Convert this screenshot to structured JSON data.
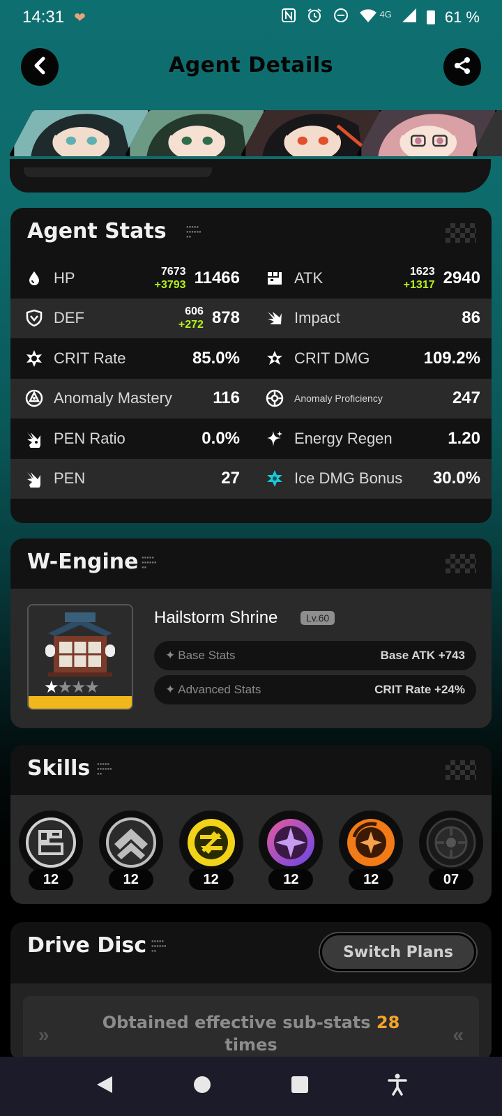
{
  "status_bar": {
    "time": "14:31",
    "network": "4G",
    "battery": "61 %",
    "icons": [
      "heart-icon",
      "nfc-icon",
      "alarm-icon",
      "dnd-icon",
      "wifi-icon",
      "signal-icon",
      "battery-icon"
    ]
  },
  "header": {
    "title": "Agent Details",
    "back_icon": "chevron-left-icon",
    "share_icon": "share-icon"
  },
  "agents": [
    {
      "name": "agent-1",
      "hair": "#1f2a2c",
      "accent": "#6fb2b6"
    },
    {
      "name": "agent-2",
      "hair": "#24382c",
      "accent": "#3c8a55"
    },
    {
      "name": "agent-3",
      "hair": "#17171a",
      "accent": "#e2502b"
    },
    {
      "name": "agent-4",
      "hair": "#d9a0a6",
      "accent": "#c77a93"
    },
    {
      "name": "agent-5",
      "hair": "#333",
      "accent": "#555"
    }
  ],
  "agent_stats": {
    "title": "Agent Stats",
    "rows": [
      {
        "left": {
          "icon": "hp-drop-icon",
          "name": "HP",
          "base": "7673",
          "bonus": "+3793",
          "value": "11466"
        },
        "right": {
          "icon": "atk-fist-icon",
          "name": "ATK",
          "base": "1623",
          "bonus": "+1317",
          "value": "2940"
        }
      },
      {
        "left": {
          "icon": "def-shield-icon",
          "name": "DEF",
          "base": "606",
          "bonus": "+272",
          "value": "878"
        },
        "right": {
          "icon": "impact-icon",
          "name": "Impact",
          "value": "86"
        }
      },
      {
        "left": {
          "icon": "crit-rate-icon",
          "name": "CRIT Rate",
          "value": "85.0%"
        },
        "right": {
          "icon": "crit-dmg-icon",
          "name": "CRIT DMG",
          "value": "109.2%"
        }
      },
      {
        "left": {
          "icon": "anomaly-mastery-icon",
          "name": "Anomaly Mastery",
          "value": "116"
        },
        "right": {
          "icon": "anomaly-proficiency-icon",
          "name": "Anomaly Proficiency",
          "value": "247"
        }
      },
      {
        "left": {
          "icon": "pen-ratio-icon",
          "name": "PEN Ratio",
          "value": "0.0%"
        },
        "right": {
          "icon": "energy-regen-icon",
          "name": "Energy Regen",
          "value": "1.20"
        }
      },
      {
        "left": {
          "icon": "pen-icon",
          "name": "PEN",
          "value": "27"
        },
        "right": {
          "icon": "ice-star-icon",
          "name": "Ice DMG Bonus",
          "value": "30.0%"
        }
      }
    ]
  },
  "wengine": {
    "title": "W-Engine",
    "name": "Hailstorm Shrine",
    "level": "Lv.60",
    "stars_filled": 1,
    "stars_total": 4,
    "base_stats_label": "Base Stats",
    "base_stats_value": "Base ATK +743",
    "advanced_stats_label": "Advanced Stats",
    "advanced_stats_value": "CRIT Rate +24%",
    "rarity_color": "#f0b81a"
  },
  "skills": {
    "title": "Skills",
    "items": [
      {
        "icon": "basic-attack-icon",
        "level": "12",
        "color": "#cfcfcf"
      },
      {
        "icon": "dodge-icon",
        "level": "12",
        "color": "#bdbdbd"
      },
      {
        "icon": "assist-icon",
        "level": "12",
        "color": "#f3d31a"
      },
      {
        "icon": "special-attack-icon",
        "level": "12",
        "color": "#c14bd8"
      },
      {
        "icon": "chain-attack-icon",
        "level": "12",
        "color": "#f27a17"
      },
      {
        "icon": "core-skill-icon",
        "level": "07",
        "color": "#3a3a3a"
      }
    ]
  },
  "drive_disc": {
    "title": "Drive Disc",
    "switch_label": "Switch Plans",
    "obtained_prefix": "Obtained effective sub-stats",
    "obtained_count": "28",
    "obtained_suffix": "times"
  },
  "colors": {
    "accent_green": "#b6f21a",
    "highlight_orange": "#f5a42a",
    "bg_teal": "#0e6f70"
  }
}
